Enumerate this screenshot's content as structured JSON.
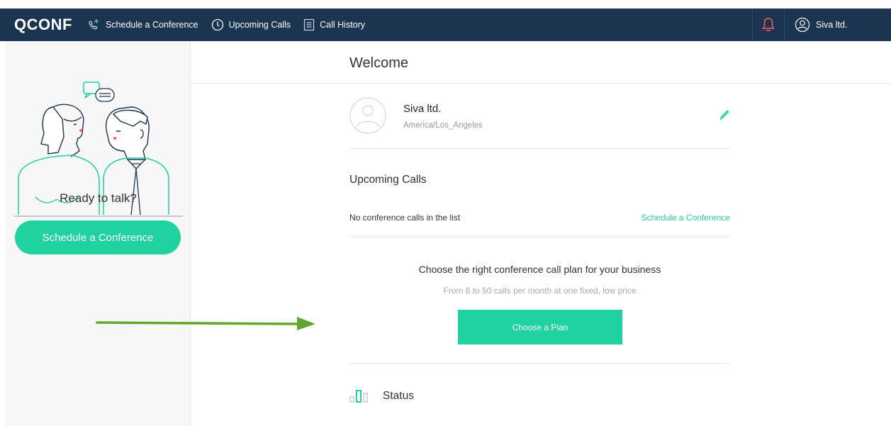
{
  "navbar": {
    "logo": "QCONF",
    "items": [
      {
        "label": "Schedule a Conference",
        "icon": "phone-plus-icon"
      },
      {
        "label": "Upcoming Calls",
        "icon": "clock-icon"
      },
      {
        "label": "Call History",
        "icon": "document-icon"
      }
    ],
    "bell_icon": "bell-icon",
    "user_name": "Siva ltd.",
    "user_icon": "user-icon"
  },
  "sidebar": {
    "ready_text": "Ready to talk?",
    "cta_label": "Schedule a Conference"
  },
  "main": {
    "welcome_title": "Welcome",
    "profile": {
      "name": "Siva ltd.",
      "timezone": "America/Los_Angeles"
    },
    "upcoming": {
      "title": "Upcoming Calls",
      "empty_text": "No conference calls in the list",
      "schedule_link": "Schedule a Conference"
    },
    "plan": {
      "title": "Choose the right conference call plan for your business",
      "subtitle": "From 8 to 50 calls per month at one fixed, low price",
      "button_label": "Choose a Plan"
    },
    "status": {
      "title": "Status"
    }
  },
  "colors": {
    "navbar_bg": "#1b3550",
    "accent": "#1fd2a0",
    "bell": "#ff5a5a",
    "annotation_arrow": "#5fa832"
  }
}
